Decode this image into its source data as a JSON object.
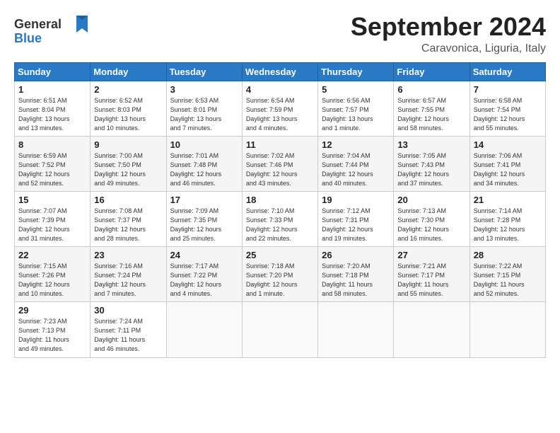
{
  "header": {
    "logo_line1": "General",
    "logo_line2": "Blue",
    "month_title": "September 2024",
    "location": "Caravonica, Liguria, Italy"
  },
  "weekdays": [
    "Sunday",
    "Monday",
    "Tuesday",
    "Wednesday",
    "Thursday",
    "Friday",
    "Saturday"
  ],
  "weeks": [
    [
      {
        "day": "1",
        "info": "Sunrise: 6:51 AM\nSunset: 8:04 PM\nDaylight: 13 hours\nand 13 minutes."
      },
      {
        "day": "2",
        "info": "Sunrise: 6:52 AM\nSunset: 8:03 PM\nDaylight: 13 hours\nand 10 minutes."
      },
      {
        "day": "3",
        "info": "Sunrise: 6:53 AM\nSunset: 8:01 PM\nDaylight: 13 hours\nand 7 minutes."
      },
      {
        "day": "4",
        "info": "Sunrise: 6:54 AM\nSunset: 7:59 PM\nDaylight: 13 hours\nand 4 minutes."
      },
      {
        "day": "5",
        "info": "Sunrise: 6:56 AM\nSunset: 7:57 PM\nDaylight: 13 hours\nand 1 minute."
      },
      {
        "day": "6",
        "info": "Sunrise: 6:57 AM\nSunset: 7:55 PM\nDaylight: 12 hours\nand 58 minutes."
      },
      {
        "day": "7",
        "info": "Sunrise: 6:58 AM\nSunset: 7:54 PM\nDaylight: 12 hours\nand 55 minutes."
      }
    ],
    [
      {
        "day": "8",
        "info": "Sunrise: 6:59 AM\nSunset: 7:52 PM\nDaylight: 12 hours\nand 52 minutes."
      },
      {
        "day": "9",
        "info": "Sunrise: 7:00 AM\nSunset: 7:50 PM\nDaylight: 12 hours\nand 49 minutes."
      },
      {
        "day": "10",
        "info": "Sunrise: 7:01 AM\nSunset: 7:48 PM\nDaylight: 12 hours\nand 46 minutes."
      },
      {
        "day": "11",
        "info": "Sunrise: 7:02 AM\nSunset: 7:46 PM\nDaylight: 12 hours\nand 43 minutes."
      },
      {
        "day": "12",
        "info": "Sunrise: 7:04 AM\nSunset: 7:44 PM\nDaylight: 12 hours\nand 40 minutes."
      },
      {
        "day": "13",
        "info": "Sunrise: 7:05 AM\nSunset: 7:43 PM\nDaylight: 12 hours\nand 37 minutes."
      },
      {
        "day": "14",
        "info": "Sunrise: 7:06 AM\nSunset: 7:41 PM\nDaylight: 12 hours\nand 34 minutes."
      }
    ],
    [
      {
        "day": "15",
        "info": "Sunrise: 7:07 AM\nSunset: 7:39 PM\nDaylight: 12 hours\nand 31 minutes."
      },
      {
        "day": "16",
        "info": "Sunrise: 7:08 AM\nSunset: 7:37 PM\nDaylight: 12 hours\nand 28 minutes."
      },
      {
        "day": "17",
        "info": "Sunrise: 7:09 AM\nSunset: 7:35 PM\nDaylight: 12 hours\nand 25 minutes."
      },
      {
        "day": "18",
        "info": "Sunrise: 7:10 AM\nSunset: 7:33 PM\nDaylight: 12 hours\nand 22 minutes."
      },
      {
        "day": "19",
        "info": "Sunrise: 7:12 AM\nSunset: 7:31 PM\nDaylight: 12 hours\nand 19 minutes."
      },
      {
        "day": "20",
        "info": "Sunrise: 7:13 AM\nSunset: 7:30 PM\nDaylight: 12 hours\nand 16 minutes."
      },
      {
        "day": "21",
        "info": "Sunrise: 7:14 AM\nSunset: 7:28 PM\nDaylight: 12 hours\nand 13 minutes."
      }
    ],
    [
      {
        "day": "22",
        "info": "Sunrise: 7:15 AM\nSunset: 7:26 PM\nDaylight: 12 hours\nand 10 minutes."
      },
      {
        "day": "23",
        "info": "Sunrise: 7:16 AM\nSunset: 7:24 PM\nDaylight: 12 hours\nand 7 minutes."
      },
      {
        "day": "24",
        "info": "Sunrise: 7:17 AM\nSunset: 7:22 PM\nDaylight: 12 hours\nand 4 minutes."
      },
      {
        "day": "25",
        "info": "Sunrise: 7:18 AM\nSunset: 7:20 PM\nDaylight: 12 hours\nand 1 minute."
      },
      {
        "day": "26",
        "info": "Sunrise: 7:20 AM\nSunset: 7:18 PM\nDaylight: 11 hours\nand 58 minutes."
      },
      {
        "day": "27",
        "info": "Sunrise: 7:21 AM\nSunset: 7:17 PM\nDaylight: 11 hours\nand 55 minutes."
      },
      {
        "day": "28",
        "info": "Sunrise: 7:22 AM\nSunset: 7:15 PM\nDaylight: 11 hours\nand 52 minutes."
      }
    ],
    [
      {
        "day": "29",
        "info": "Sunrise: 7:23 AM\nSunset: 7:13 PM\nDaylight: 11 hours\nand 49 minutes."
      },
      {
        "day": "30",
        "info": "Sunrise: 7:24 AM\nSunset: 7:11 PM\nDaylight: 11 hours\nand 46 minutes."
      },
      {
        "day": "",
        "info": ""
      },
      {
        "day": "",
        "info": ""
      },
      {
        "day": "",
        "info": ""
      },
      {
        "day": "",
        "info": ""
      },
      {
        "day": "",
        "info": ""
      }
    ]
  ]
}
